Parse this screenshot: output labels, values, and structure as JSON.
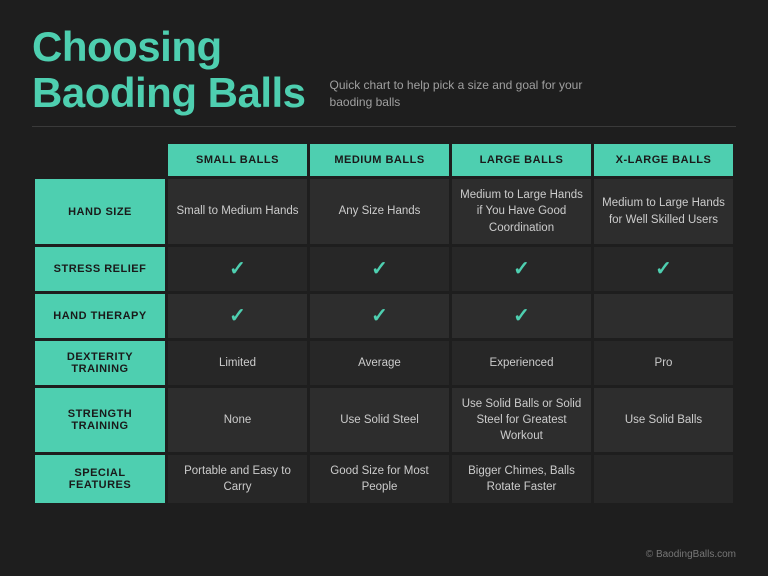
{
  "header": {
    "title_line1": "Choosing",
    "title_line2": "Baoding Balls",
    "subtitle": "Quick chart to help pick a size and goal for your baoding balls"
  },
  "table": {
    "columns": [
      "SMALL BALLS",
      "MEDIUM BALLS",
      "LARGE BALLS",
      "X-LARGE BALLS"
    ],
    "rows": [
      {
        "label": "HAND SIZE",
        "values": [
          "Small to Medium Hands",
          "Any Size Hands",
          "Medium to Large Hands if You Have Good Coordination",
          "Medium to Large Hands for Well Skilled Users"
        ]
      },
      {
        "label": "STRESS RELIEF",
        "values": [
          "✓",
          "✓",
          "✓",
          "✓"
        ]
      },
      {
        "label": "HAND THERAPY",
        "values": [
          "✓",
          "✓",
          "✓",
          ""
        ]
      },
      {
        "label": "DEXTERITY TRAINING",
        "values": [
          "Limited",
          "Average",
          "Experienced",
          "Pro"
        ]
      },
      {
        "label": "STRENGTH TRAINING",
        "values": [
          "None",
          "Use Solid Steel",
          "Use Solid Balls or Solid Steel for Greatest Workout",
          "Use Solid Balls"
        ]
      },
      {
        "label": "SPECIAL FEATURES",
        "values": [
          "Portable and Easy to Carry",
          "Good Size for Most People",
          "Bigger Chimes, Balls Rotate Faster",
          ""
        ]
      }
    ]
  },
  "watermark": "© BaodingBalls.com"
}
